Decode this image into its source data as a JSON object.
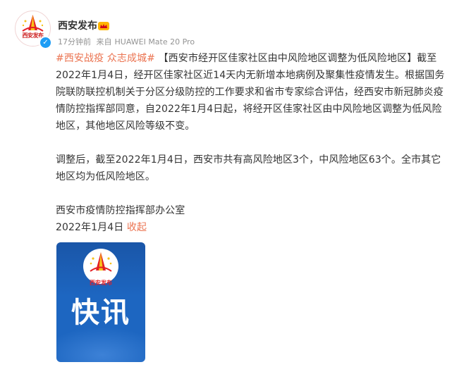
{
  "author": {
    "name": "西安发布",
    "avatar_text": "西安发布",
    "verified": true
  },
  "meta": {
    "time": "17分钟前",
    "source_prefix": "来自",
    "device": "HUAWEI Mate 20 Pro"
  },
  "post": {
    "hashtag": "#西安战疫 众志成城#",
    "para1": "【西安市经开区佳家社区由中风险地区调整为低风险地区】截至2022年1月4日，经开区佳家社区近14天内无新增本地病例及聚集性疫情发生。根据国务院联防联控机制关于分区分级防控的工作要求和省市专家综合评估，经西安市新冠肺炎疫情防控指挥部同意，自2022年1月4日起，将经开区佳家社区由中风险地区调整为低风险地区，其他地区风险等级不变。",
    "para2": "调整后，截至2022年1月4日，西安市共有高风险地区3个，中风险地区63个。全市其它地区均为低风险地区。",
    "signature": "西安市疫情防控指挥部办公室",
    "date": "2022年1月4日",
    "collapse_label": "收起"
  },
  "image_card": {
    "emblem_text": "西安发布",
    "title": "快讯"
  },
  "colors": {
    "link": "#eb7350",
    "text": "#333333",
    "meta": "#939393",
    "verify": "#1e9df5",
    "card_blue": "#1d66c1"
  }
}
